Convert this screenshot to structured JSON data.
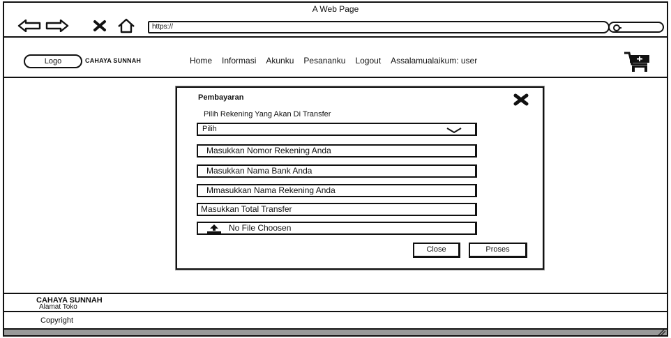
{
  "window": {
    "title": "A Web Page"
  },
  "browser": {
    "url": "https://",
    "icons": [
      "back-arrow-icon",
      "forward-arrow-icon",
      "close-x-icon",
      "home-icon",
      "search-icon"
    ]
  },
  "header": {
    "logo_label": "Logo",
    "brand": "CAHAYA SUNNAH",
    "nav": [
      "Home",
      "Informasi",
      "Akunku",
      "Pesananku",
      "Logout",
      "Assalamualaikum: user"
    ]
  },
  "modal": {
    "title": "Pembayaran",
    "subtitle": "Pilih Rekening Yang Akan Di Transfer",
    "select_value": "Pilih",
    "fields": [
      "Masukkan Nomor Rekening Anda",
      "Masukkan Nama Bank Anda",
      "Mmasukkan Nama Rekening Anda",
      "Masukkan Total Transfer"
    ],
    "file_label": "No File Choosen",
    "close_label": "Close",
    "submit_label": "Proses"
  },
  "footer": {
    "brand": "CAHAYA SUNNAH",
    "address": "Alamat Toko",
    "copyright": "Copyright"
  }
}
